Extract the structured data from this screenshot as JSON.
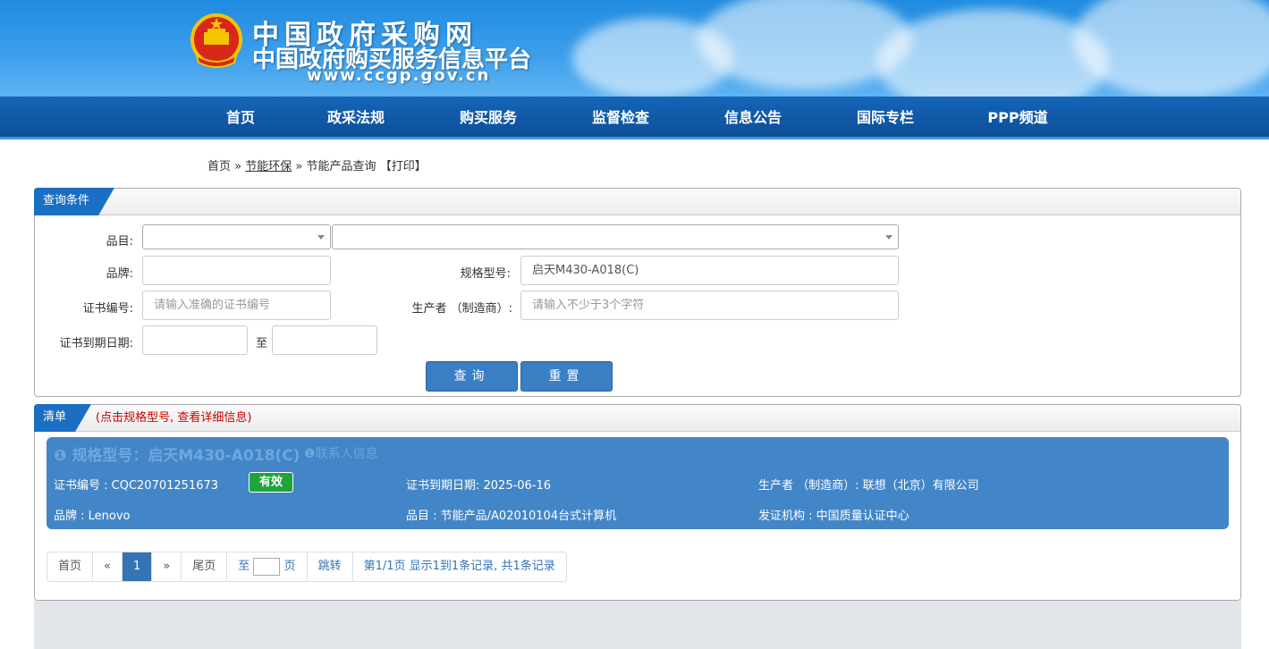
{
  "header": {
    "title": "中国政府采购网",
    "subtitle": "中国政府购买服务信息平台",
    "url": "www.ccgp.gov.cn"
  },
  "nav": {
    "items": [
      {
        "label": "首页"
      },
      {
        "label": "政采法规"
      },
      {
        "label": "购买服务"
      },
      {
        "label": "监督检查"
      },
      {
        "label": "信息公告"
      },
      {
        "label": "国际专栏"
      },
      {
        "label": "PPP频道"
      }
    ]
  },
  "breadcrumb": {
    "home": "首页",
    "sep1": "»",
    "section": "节能环保",
    "sep2": "»",
    "current": "节能产品查询",
    "print": "【打印】"
  },
  "query": {
    "panel_title": "查询条件",
    "category_label": "品目:",
    "brand_label": "品牌:",
    "brand_value": "",
    "model_label": "规格型号:",
    "model_value": "启天M430-A018(C)",
    "cert_no_label": "证书编号:",
    "cert_no_placeholder": "请输入准确的证书编号",
    "maker_label": "生产者 （制造商）:",
    "maker_placeholder": "请输入不少于3个字符",
    "expiry_label": "证书到期日期:",
    "to_label": "至",
    "search_button": "查询",
    "reset_button": "重置"
  },
  "results": {
    "panel_title": "清单",
    "note": "(点击规格型号, 查看详细信息)",
    "items": [
      {
        "title": "规格型号：启天M430-A018(C)",
        "contact": "联系人信息",
        "cert_no": "证书编号 : CQC20701251673",
        "status": "有效",
        "expiry": "证书到期日期: 2025-06-16",
        "maker": "生产者 （制造商）: 联想（北京）有限公司",
        "brand": "品牌 : Lenovo",
        "category": "品目 : 节能产品/A02010104台式计算机",
        "issuer": "发证机构 : 中国质量认证中心"
      }
    ]
  },
  "pagination": {
    "first": "首页",
    "prev": "«",
    "current_page": "1",
    "next": "»",
    "last": "尾页",
    "goto_prefix": "至",
    "goto_suffix": "页",
    "jump": "跳转",
    "info": "第1/1页  显示1到1条记录, 共1条记录"
  },
  "colors": {
    "banner": "#2a93e6",
    "nav": "#0f58a6",
    "accent": "#1a6fc4",
    "card": "#4286c8",
    "valid_badge": "#1ea43a",
    "note": "#cc0000"
  }
}
